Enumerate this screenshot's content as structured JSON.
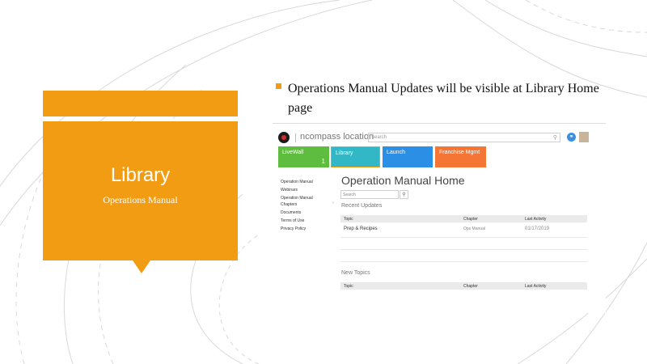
{
  "slide": {
    "title": "Library",
    "subtitle": "Operations  Manual",
    "bullet": "Operations Manual Updates will be visible at Library Home page",
    "accent_color": "#f29c14"
  },
  "app": {
    "brand": "ncompass location",
    "search_placeholder": "Search",
    "tiles": [
      {
        "label": "LiveWall",
        "count": "1",
        "color": "#5ebc3e"
      },
      {
        "label": "Library",
        "color": "#31b7c6"
      },
      {
        "label": "Launch",
        "color": "#2c8fe6"
      },
      {
        "label": "Franchise Mgmt",
        "color": "#f47534"
      }
    ],
    "sidebar": [
      "Operation Manual",
      "Webinars",
      "Operation Manual Chapters",
      "Documents",
      "Terms of Use",
      "Privacy Policy"
    ],
    "page_title": "Operation Manual Home",
    "main_search_placeholder": "Search",
    "recent": {
      "heading": "Recent Updates",
      "columns": [
        "Topic",
        "Chapter",
        "Last Activity"
      ],
      "rows": [
        {
          "topic": "Prep & Recipes",
          "chapter": "Ops Manual",
          "date": "01/17/2019"
        }
      ]
    },
    "new_topics": {
      "heading": "New Topics",
      "columns": [
        "Topic",
        "Chapter",
        "Last Activity"
      ]
    }
  }
}
